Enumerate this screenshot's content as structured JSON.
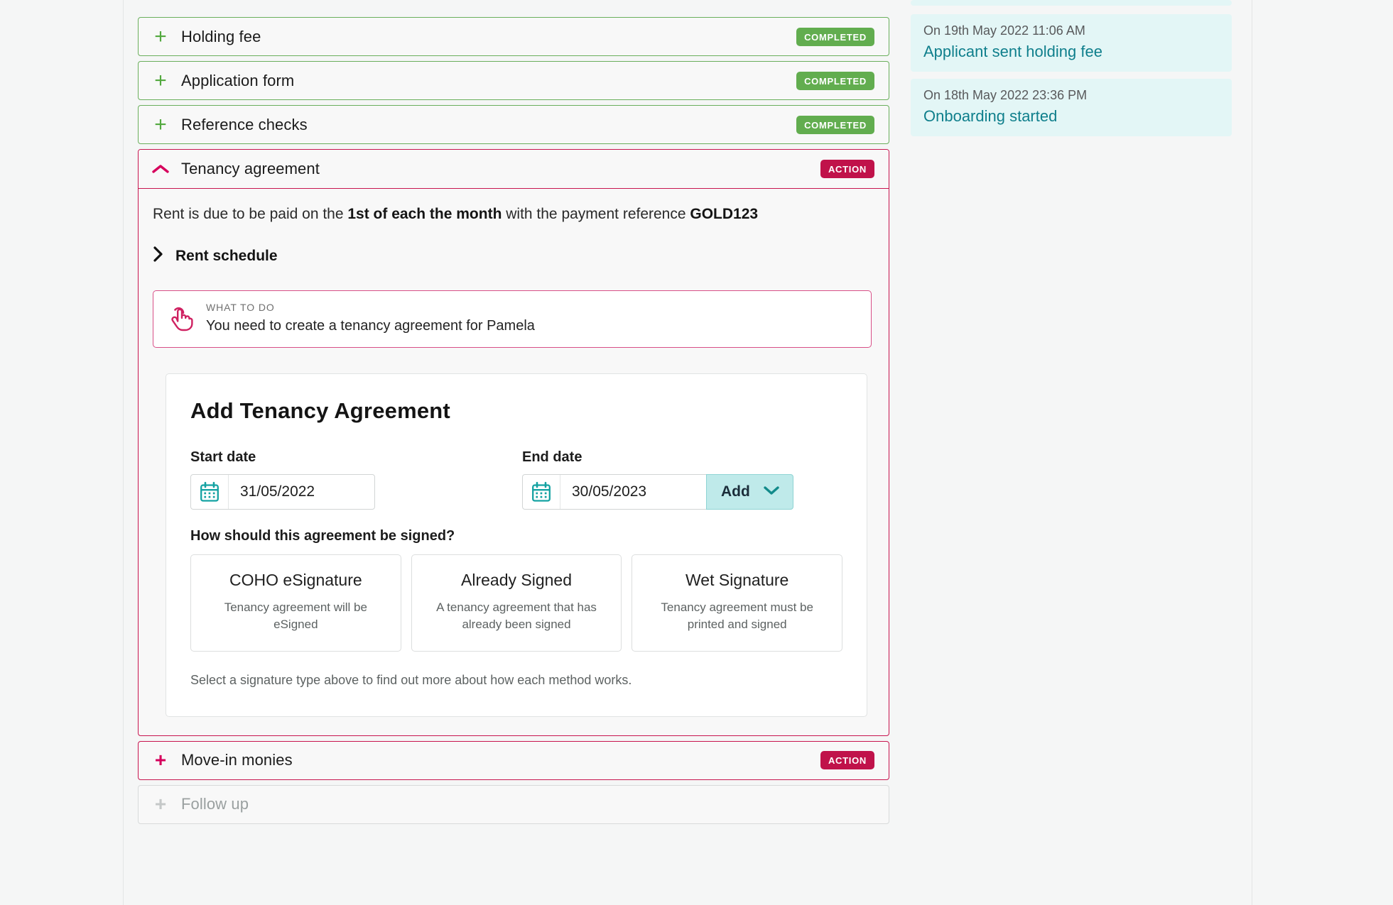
{
  "accordion": {
    "sections": [
      {
        "id": "holding-fee",
        "title": "Holding fee",
        "icon": "plus-icon",
        "state": "completed",
        "badge": "COMPLETED"
      },
      {
        "id": "application-form",
        "title": "Application form",
        "icon": "plus-icon",
        "state": "completed",
        "badge": "COMPLETED"
      },
      {
        "id": "reference-checks",
        "title": "Reference checks",
        "icon": "plus-icon",
        "state": "completed",
        "badge": "COMPLETED"
      },
      {
        "id": "tenancy-agreement",
        "title": "Tenancy agreement",
        "icon": "chevron-up-icon",
        "state": "action",
        "badge": "ACTION"
      },
      {
        "id": "move-in-monies",
        "title": "Move-in monies",
        "icon": "plus-icon",
        "state": "action",
        "badge": "ACTION"
      },
      {
        "id": "follow-up",
        "title": "Follow up",
        "icon": "plus-icon",
        "state": "disabled",
        "badge": ""
      }
    ]
  },
  "tenancy": {
    "rent_text_part1": "Rent is due to be paid on the ",
    "rent_day": "1st of each the month",
    "rent_text_part2": " with the payment reference ",
    "rent_reference": "GOLD123",
    "rent_schedule_label": "Rent schedule",
    "rent_schedule_icon": "chevron-right-icon",
    "callout": {
      "icon": "pointing-hand-icon",
      "kicker": "WHAT TO DO",
      "message": "You need to create a tenancy agreement for Pamela"
    }
  },
  "form": {
    "title": "Add Tenancy Agreement",
    "start_date": {
      "label": "Start date",
      "value": "31/05/2022",
      "placeholder": "DD/MM/YYYY",
      "icon": "calendar-icon"
    },
    "end_date": {
      "label": "End date",
      "value": "30/05/2023",
      "placeholder": "DD/MM/YYYY",
      "icon": "calendar-icon"
    },
    "add_button": {
      "label": "Add",
      "icon": "chevron-down-icon"
    },
    "signature_question": "How should this agreement be signed?",
    "signature_options": [
      {
        "title": "COHO eSignature",
        "description": "Tenancy agreement will be eSigned"
      },
      {
        "title": "Already Signed",
        "description": "A tenancy agreement that has already been signed"
      },
      {
        "title": "Wet Signature",
        "description": "Tenancy agreement must be printed and signed"
      }
    ],
    "signature_help": "Select a signature type above to find out more about how each method works."
  },
  "activity": {
    "items": [
      {
        "when": "On 19th May 2022 11:06 AM",
        "what": "Applicant sent holding fee"
      },
      {
        "when": "On 18th May 2022 23:36 PM",
        "what": "Onboarding started"
      }
    ]
  },
  "colors": {
    "success": "#62ad4f",
    "action": "#c0124a",
    "accent_pink": "#c8154f",
    "teal": "#14a2a2",
    "activity_bg": "#e3f6f6",
    "activity_text": "#0f7f8c",
    "page_bg": "#f5f6f6"
  }
}
